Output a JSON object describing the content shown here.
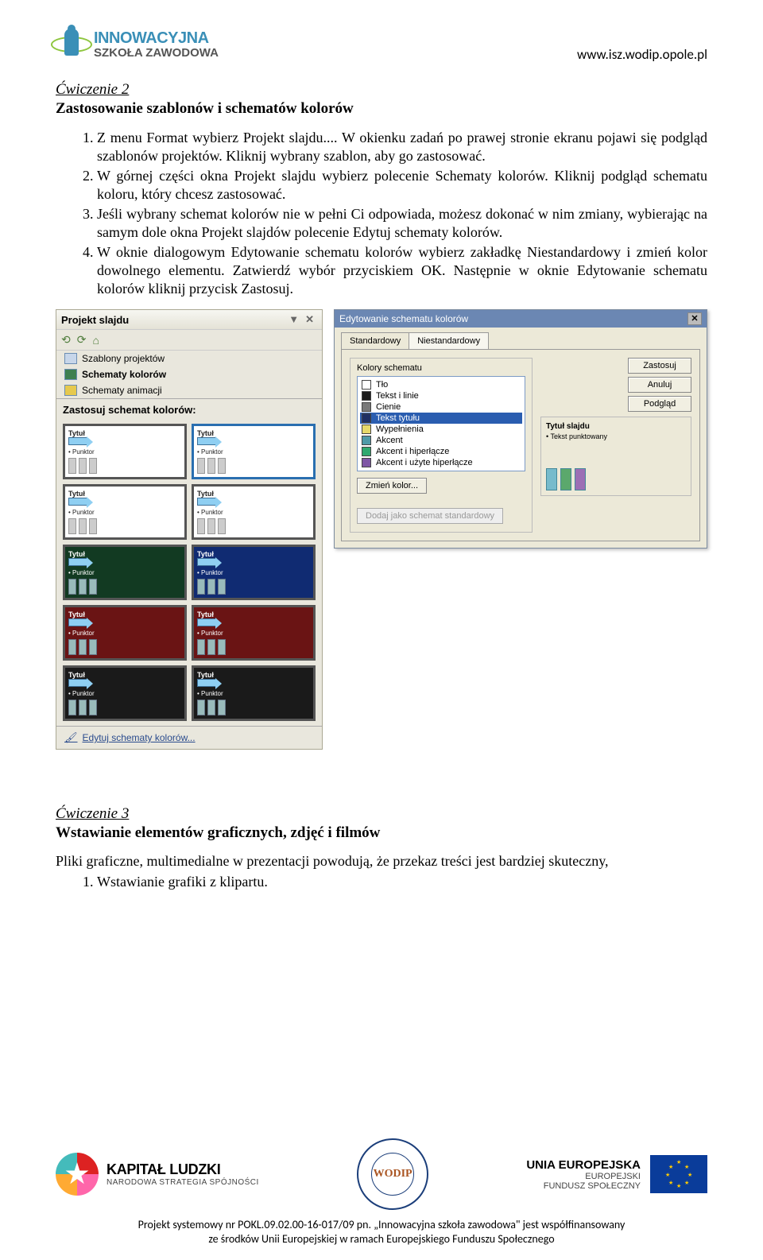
{
  "header": {
    "logo_line1": "INNOWACYJNA",
    "logo_line2": "SZKOŁA ZAWODOWA",
    "url": "www.isz.wodip.opole.pl"
  },
  "ex2": {
    "title": "Ćwiczenie  2",
    "subtitle": "Zastosowanie szablonów i schematów kolorów",
    "steps": [
      "Z menu Format wybierz Projekt slajdu.... W okienku zadań po prawej stronie ekranu pojawi się podgląd szablonów projektów. Kliknij wybrany szablon, aby go zastosować.",
      "W górnej części okna Projekt slajdu wybierz polecenie Schematy kolorów. Kliknij podgląd schematu koloru, który chcesz zastosować.",
      "Jeśli wybrany schemat kolorów nie w pełni Ci odpowiada, możesz dokonać w nim zmiany, wybierając na samym dole okna Projekt slajdów polecenie Edytuj schematy kolorów.",
      "W oknie dialogowym Edytowanie schematu kolorów wybierz zakładkę Niestandardowy i zmień kolor dowolnego elementu. Zatwierdź wybór przyciskiem OK. Następnie w oknie Edytowanie schematu kolorów kliknij przycisk Zastosuj."
    ]
  },
  "leftpanel": {
    "title": "Projekt slajdu",
    "links": [
      "Szablony projektów",
      "Schematy kolorów",
      "Schematy animacji"
    ],
    "section_header": "Zastosuj schemat kolorów:",
    "thumb_title": "Tytuł",
    "thumb_bullet": "Punktor",
    "footer_link": "Edytuj schematy kolorów..."
  },
  "rightpanel": {
    "title": "Edytowanie schematu kolorów",
    "tabs": [
      "Standardowy",
      "Niestandardowy"
    ],
    "group_header": "Kolory schematu",
    "items": [
      {
        "label": "Tło",
        "color": "#ffffff"
      },
      {
        "label": "Tekst i linie",
        "color": "#1a1a1a"
      },
      {
        "label": "Cienie",
        "color": "#7a7a7a"
      },
      {
        "label": "Tekst tytułu",
        "color": "#1e2f63",
        "selected": true
      },
      {
        "label": "Wypełnienia",
        "color": "#e6d96a"
      },
      {
        "label": "Akcent",
        "color": "#4f9aa8"
      },
      {
        "label": "Akcent i hiperłącze",
        "color": "#2fa86f"
      },
      {
        "label": "Akcent i użyte hiperłącze",
        "color": "#7e56a5"
      }
    ],
    "change_color_btn": "Zmień kolor...",
    "buttons": {
      "apply": "Zastosuj",
      "cancel": "Anuluj",
      "preview": "Podgląd"
    },
    "preview_title": "Tytuł slajdu",
    "preview_bullet": "Tekst punktowany",
    "bottom_btn": "Dodaj jako schemat standardowy"
  },
  "ex3": {
    "title": "Ćwiczenie 3",
    "subtitle": "Wstawianie elementów graficznych, zdjęć i filmów",
    "body": "Pliki graficzne, multimedialne w prezentacji powodują, że przekaz treści jest bardziej skuteczny,",
    "step1": "Wstawianie grafiki z klipartu."
  },
  "footer": {
    "kl_line1": "KAPITAŁ LUDZKI",
    "kl_line2": "NARODOWA STRATEGIA SPÓJNOŚCI",
    "mid_center": "WODIP",
    "eu_line1": "UNIA EUROPEJSKA",
    "eu_line2": "EUROPEJSKI",
    "eu_line3": "FUNDUSZ SPOŁECZNY",
    "line1": "Projekt systemowy nr POKL.09.02.00-16-017/09 pn. „Innowacyjna szkoła zawodowa\" jest współfinansowany",
    "line2": "ze środków Unii Europejskiej w ramach Europejskiego Funduszu Społecznego"
  }
}
